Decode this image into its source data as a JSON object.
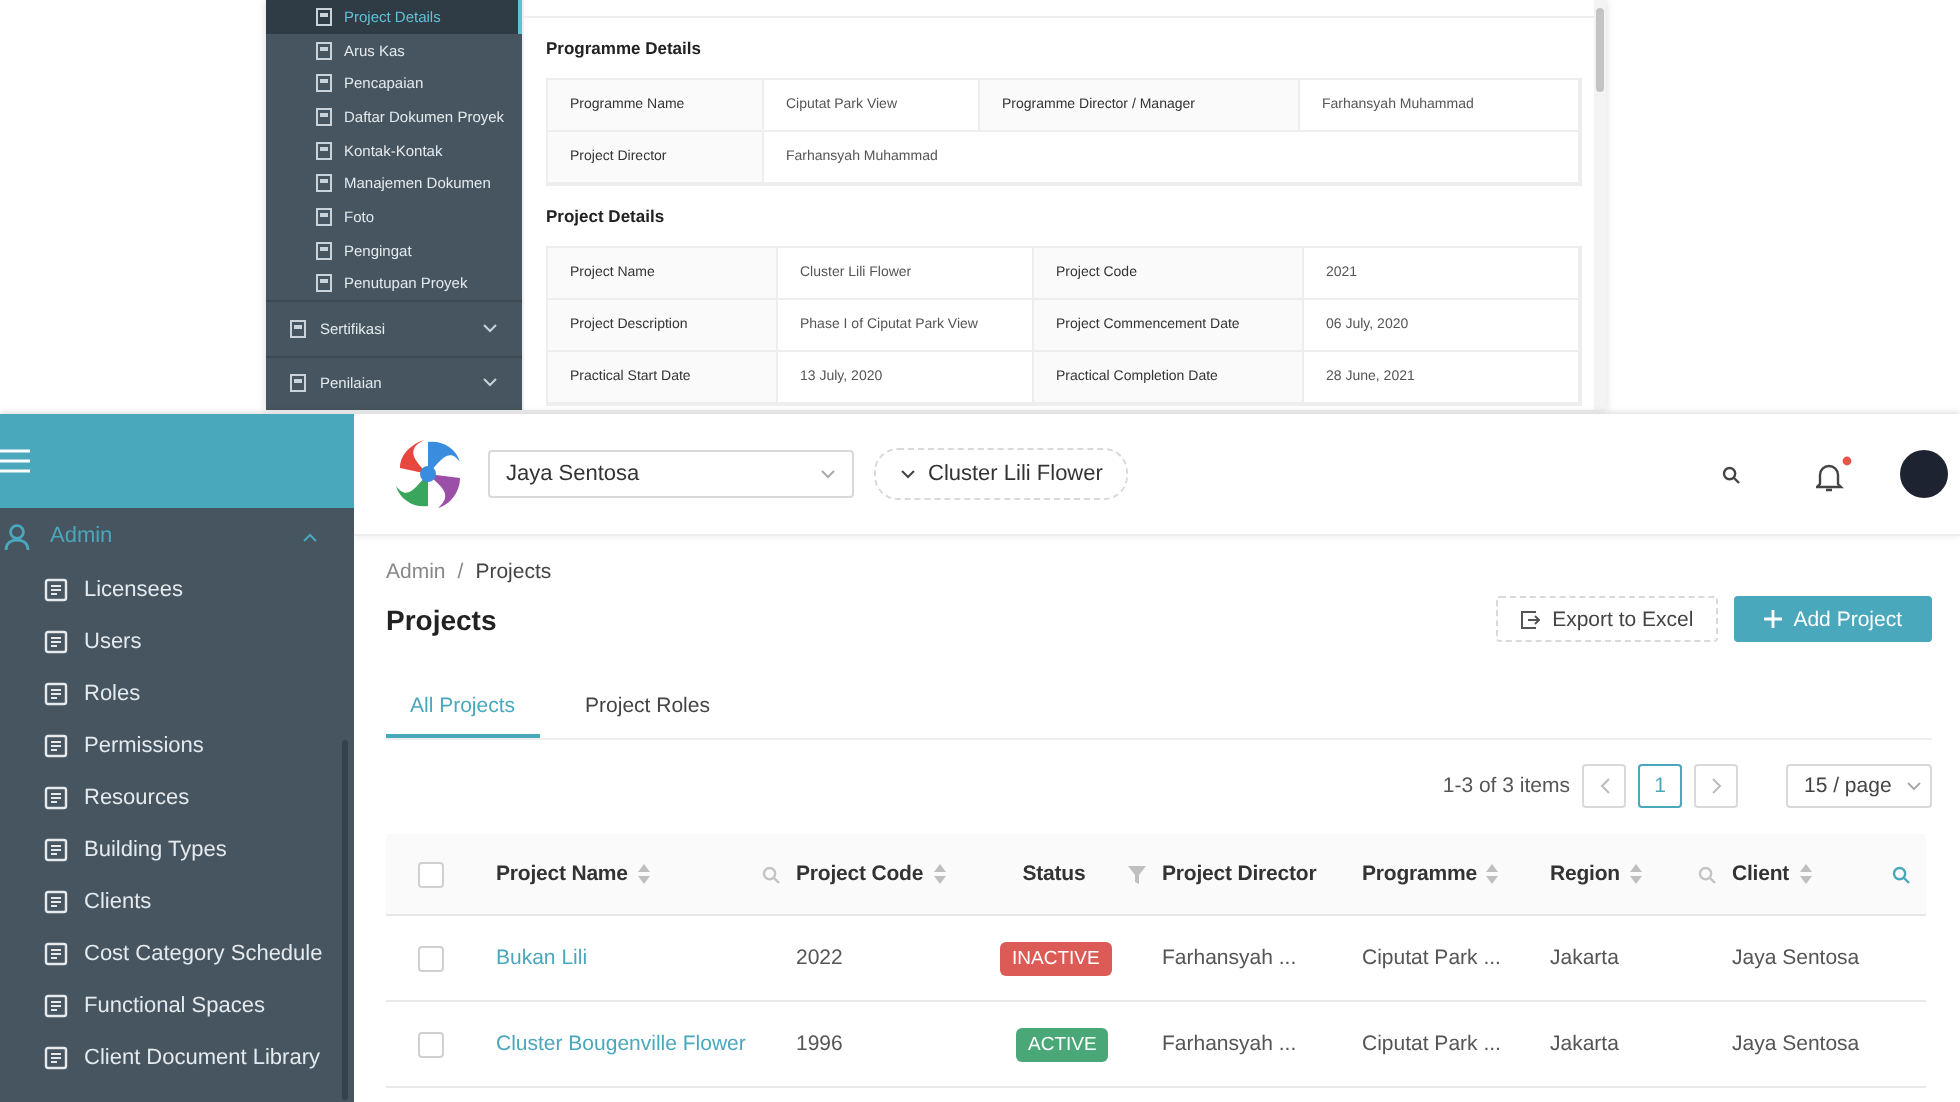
{
  "top_window": {
    "sidebar": {
      "items": [
        {
          "label": "Project Details",
          "selected": true
        },
        {
          "label": "Arus Kas",
          "selected": false
        },
        {
          "label": "Pencapaian",
          "selected": false
        },
        {
          "label": "Daftar Dokumen Proyek",
          "selected": false
        },
        {
          "label": "Kontak-Kontak",
          "selected": false
        },
        {
          "label": "Manajemen Dokumen",
          "selected": false
        },
        {
          "label": "Foto",
          "selected": false
        },
        {
          "label": "Pengingat",
          "selected": false
        },
        {
          "label": "Penutupan Proyek",
          "selected": false
        }
      ],
      "groups": [
        {
          "label": "Sertifikasi",
          "expanded": false
        },
        {
          "label": "Penilaian",
          "expanded": false
        }
      ]
    },
    "sections": [
      {
        "title": "Programme Details",
        "rows": [
          [
            {
              "label": "Programme Name",
              "value": "Ciputat Park View"
            },
            {
              "label": "Programme Director / Manager",
              "value": "Farhansyah Muhammad"
            }
          ],
          [
            {
              "label": "Project Director",
              "value": "Farhansyah Muhammad"
            }
          ]
        ]
      },
      {
        "title": "Project Details",
        "rows": [
          [
            {
              "label": "Project Name",
              "value": "Cluster Lili Flower"
            },
            {
              "label": "Project Code",
              "value": "2021"
            }
          ],
          [
            {
              "label": "Project Description",
              "value": "Phase I of Ciputat Park View"
            },
            {
              "label": "Project Commencement Date",
              "value": "06 July, 2020"
            }
          ],
          [
            {
              "label": "Practical Start Date",
              "value": "13 July, 2020"
            },
            {
              "label": "Practical Completion Date",
              "value": "28 June, 2021"
            }
          ]
        ]
      }
    ]
  },
  "sidebar": {
    "group": {
      "label": "Admin",
      "expanded": true
    },
    "items": [
      {
        "label": "Licensees"
      },
      {
        "label": "Users"
      },
      {
        "label": "Roles"
      },
      {
        "label": "Permissions"
      },
      {
        "label": "Resources"
      },
      {
        "label": "Building Types"
      },
      {
        "label": "Clients"
      },
      {
        "label": "Cost Category Schedule"
      },
      {
        "label": "Functional Spaces"
      },
      {
        "label": "Client Document Library"
      }
    ]
  },
  "header": {
    "company_select": {
      "value": "Jaya Sentosa"
    },
    "project_select": {
      "value": "Cluster Lili Flower"
    },
    "notifications": {
      "unread": true
    }
  },
  "breadcrumb": [
    "Admin",
    "Projects"
  ],
  "breadcrumb_separator": "/",
  "title": "Projects",
  "buttons": [
    {
      "label": "Export to Excel",
      "kind": "default"
    },
    {
      "label": "Add Project",
      "kind": "primary"
    }
  ],
  "tabs": [
    {
      "label": "All Projects",
      "selected": true
    },
    {
      "label": "Project Roles",
      "selected": false
    }
  ],
  "pagination": {
    "summary": "1-3 of 3 items",
    "pages": [
      {
        "label": "1",
        "selected": true
      }
    ],
    "page_size": "15 / page"
  },
  "table": {
    "columns": [
      {
        "label": "Project Name",
        "sortable": true,
        "searchable": true,
        "search_active": false,
        "filter": false
      },
      {
        "label": "Project Code",
        "sortable": true,
        "searchable": false,
        "filter": false
      },
      {
        "label": "Status",
        "sortable": false,
        "searchable": false,
        "filter": true
      },
      {
        "label": "Project Director",
        "sortable": false,
        "searchable": false,
        "filter": false
      },
      {
        "label": "Programme",
        "sortable": true,
        "searchable": false,
        "filter": false
      },
      {
        "label": "Region",
        "sortable": true,
        "searchable": true,
        "search_active": false,
        "filter": false
      },
      {
        "label": "Client",
        "sortable": true,
        "searchable": true,
        "search_active": true,
        "filter": false
      }
    ],
    "select_all": {
      "checked": false
    },
    "rows": [
      {
        "checked": false,
        "cells": [
          "Bukan Lili",
          "2022",
          {
            "text": "INACTIVE",
            "kind": "inactive"
          },
          "Farhansyah ...",
          "Ciputat Park ...",
          "Jakarta",
          "Jaya Sentosa"
        ]
      },
      {
        "checked": false,
        "cells": [
          "Cluster Bougenville Flower",
          "1996",
          {
            "text": "ACTIVE",
            "kind": "active"
          },
          "Farhansyah ...",
          "Ciputat Park ...",
          "Jakarta",
          "Jaya Sentosa"
        ]
      }
    ]
  }
}
